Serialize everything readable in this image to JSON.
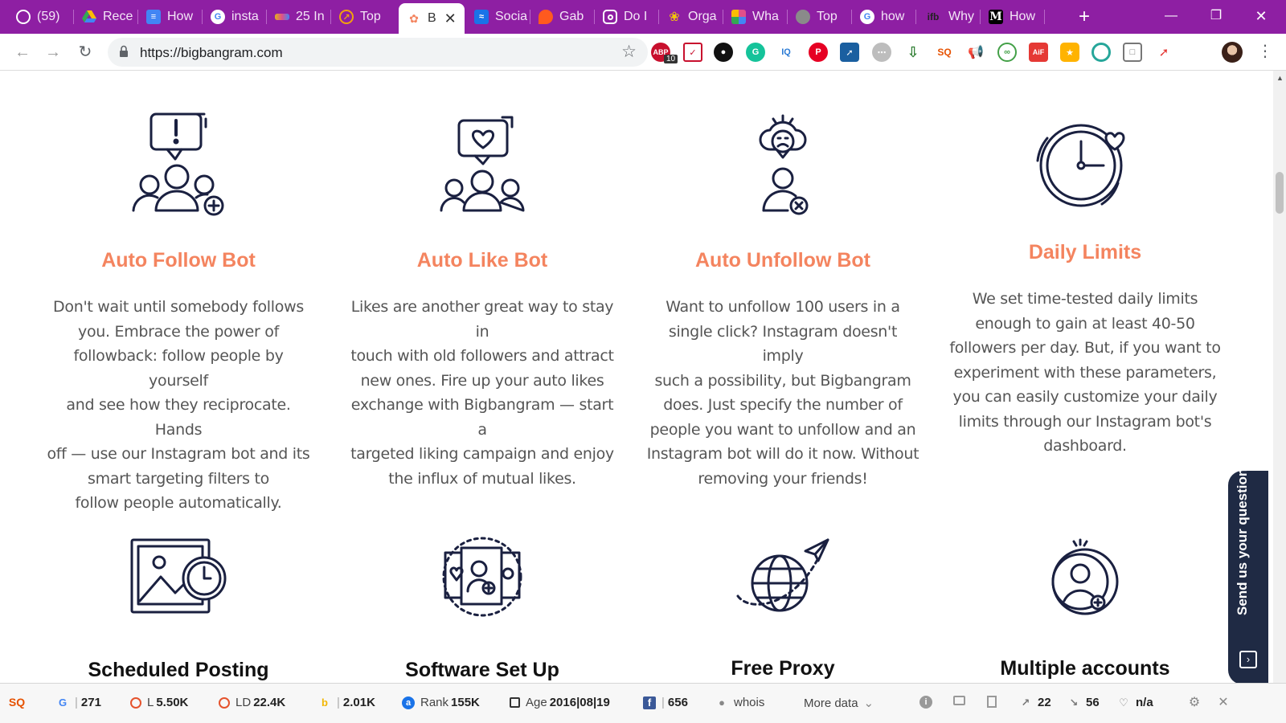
{
  "browser": {
    "tabs": [
      {
        "label": "(59)",
        "icon": "mail-icon",
        "color": "#7b8ee0"
      },
      {
        "label": "Rece",
        "icon": "drive-icon",
        "color": "#34a853"
      },
      {
        "label": "How",
        "icon": "docs-icon",
        "color": "#4285f4"
      },
      {
        "label": "insta",
        "icon": "google-icon",
        "color": "#ffffff"
      },
      {
        "label": "25 In",
        "icon": "rainbow-icon",
        "color": "#e0b21c"
      },
      {
        "label": "Top",
        "icon": "compass-icon",
        "color": "#f2a20c"
      },
      {
        "label": "B",
        "icon": "bigbangram-icon",
        "color": "#f4845f",
        "active": true
      },
      {
        "label": "Socia",
        "icon": "social-icon",
        "color": "#1a73e8"
      },
      {
        "label": "Gab",
        "icon": "flame-icon",
        "color": "#ff5a1f"
      },
      {
        "label": "Do I",
        "icon": "instagram-icon",
        "color": "#222222"
      },
      {
        "label": "Orga",
        "icon": "sunflower-icon",
        "color": "#f2c40c"
      },
      {
        "label": "Wha",
        "icon": "pinwheel-icon",
        "color": "#e04f8a"
      },
      {
        "label": "Top",
        "icon": "globe-icon",
        "color": "#888888"
      },
      {
        "label": "how",
        "icon": "google-icon",
        "color": "#ffffff"
      },
      {
        "label": "Why",
        "icon": "ifb-icon",
        "color": "#333333"
      },
      {
        "label": "How",
        "icon": "medium-icon",
        "color": "#000000"
      }
    ],
    "new_tab": "+",
    "url": "https://bigbangram.com",
    "extension_badge": "10"
  },
  "features_row1": [
    {
      "title": "Auto Follow Bot",
      "icon": "follow-group-icon",
      "lines": [
        "Don't wait until somebody follows",
        "you. Embrace the power of",
        "followback: follow people by yourself",
        "and see how they reciprocate. Hands",
        "off — use our Instagram bot and its",
        "smart targeting filters to",
        "follow people automatically."
      ]
    },
    {
      "title": "Auto Like Bot",
      "icon": "like-group-icon",
      "lines": [
        "Likes are another great way to stay in",
        "touch with old followers and attract",
        "new ones. Fire up your auto likes",
        "exchange with Bigbangram — start a",
        "targeted liking campaign and enjoy",
        "the influx of mutual likes."
      ]
    },
    {
      "title": "Auto Unfollow Bot",
      "icon": "unfollow-user-icon",
      "lines": [
        "Want to unfollow 100 users in a",
        "single click? Instagram doesn't imply",
        "such a possibility, but Bigbangram",
        "does. Just specify the number of",
        "people you want to unfollow and an",
        "Instagram bot will do it now. Without",
        "removing your friends!"
      ]
    },
    {
      "title": "Daily Limits",
      "icon": "clock-heart-icon",
      "lines": [
        "We set time-tested daily limits",
        "enough to gain at least 40-50",
        "followers per day. But, if you want to",
        "experiment with these parameters,",
        "you can easily customize your daily",
        "limits through our Instagram bot's",
        "dashboard."
      ]
    }
  ],
  "features_row2": [
    {
      "title": "Scheduled Posting",
      "icon": "scheduled-image-icon"
    },
    {
      "title": "Software Set Up",
      "icon": "software-setup-icon"
    },
    {
      "title": "Free Proxy",
      "icon": "globe-plane-icon"
    },
    {
      "title": "Multiple accounts",
      "icon": "multiple-accounts-icon"
    }
  ],
  "chat_tab": {
    "label": "Send us your question!"
  },
  "seo": {
    "google_index": "271",
    "links": {
      "label": "L",
      "value": "5.50K"
    },
    "linking_domains": {
      "label": "LD",
      "value": "22.4K"
    },
    "bing_index": "2.01K",
    "rank": {
      "label": "Rank",
      "value": "155K"
    },
    "age": {
      "label": "Age",
      "value": "2016|08|19"
    },
    "facebook": "656",
    "whois": "whois",
    "more_data": "More data",
    "external_links": "22",
    "internal_links": "56",
    "robots": "n/a"
  },
  "colors": {
    "accent": "#f4845f",
    "tabbar": "#8e1fa3",
    "icon_stroke": "#1a2040",
    "chat_tab": "#1f2a44"
  }
}
